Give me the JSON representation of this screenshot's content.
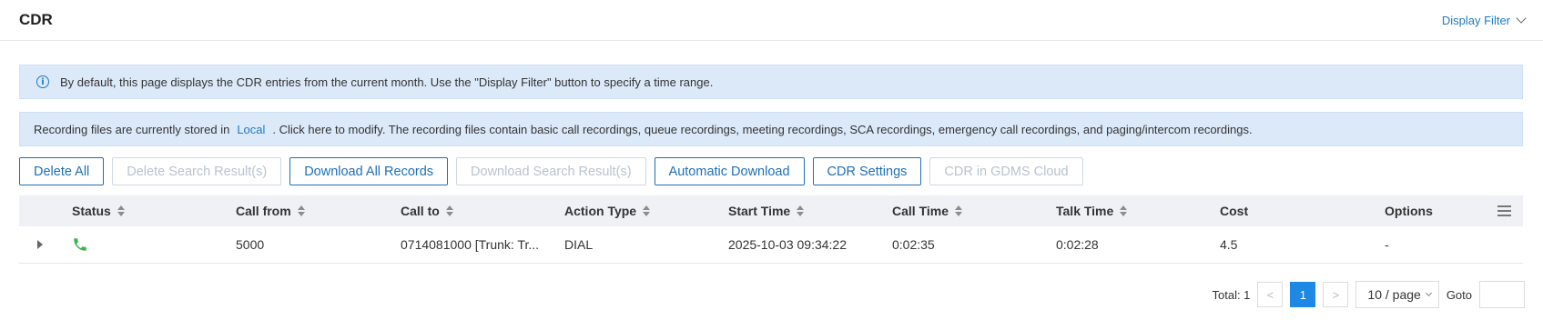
{
  "header": {
    "title": "CDR",
    "display_filter": "Display Filter"
  },
  "info": {
    "default_text": "By default, this page displays the CDR entries from the current month. Use the \"Display Filter\" button to specify a time range.",
    "recording_prefix": "Recording files are currently stored in",
    "recording_location": "Local",
    "recording_suffix": ". Click here to modify. The recording files contain basic call recordings, queue recordings, meeting recordings, SCA recordings, emergency call recordings, and paging/intercom recordings."
  },
  "toolbar": {
    "delete_all": "Delete All",
    "delete_search": "Delete Search Result(s)",
    "download_all": "Download All Records",
    "download_search": "Download Search Result(s)",
    "auto_download": "Automatic Download",
    "cdr_settings": "CDR Settings",
    "gdms_cloud": "CDR in GDMS Cloud"
  },
  "table": {
    "columns": {
      "status": "Status",
      "call_from": "Call from",
      "call_to": "Call to",
      "action_type": "Action Type",
      "start_time": "Start Time",
      "call_time": "Call Time",
      "talk_time": "Talk Time",
      "cost": "Cost",
      "options": "Options"
    },
    "rows": [
      {
        "status_icon": "phone-answered-icon",
        "call_from": "5000",
        "call_to": "0714081000 [Trunk: Tr...",
        "action_type": "DIAL",
        "start_time": "2025-10-03 09:34:22",
        "call_time": "0:02:35",
        "talk_time": "0:02:28",
        "cost": "4.5",
        "options": "-"
      }
    ]
  },
  "pagination": {
    "total": "Total: 1",
    "prev": "<",
    "current_page": "1",
    "next": ">",
    "page_size": "10 / page",
    "goto_label": "Goto"
  },
  "colors": {
    "accent": "#1f7ac0",
    "info_bg": "#dbe9f9",
    "status_green": "#3bb54a"
  }
}
